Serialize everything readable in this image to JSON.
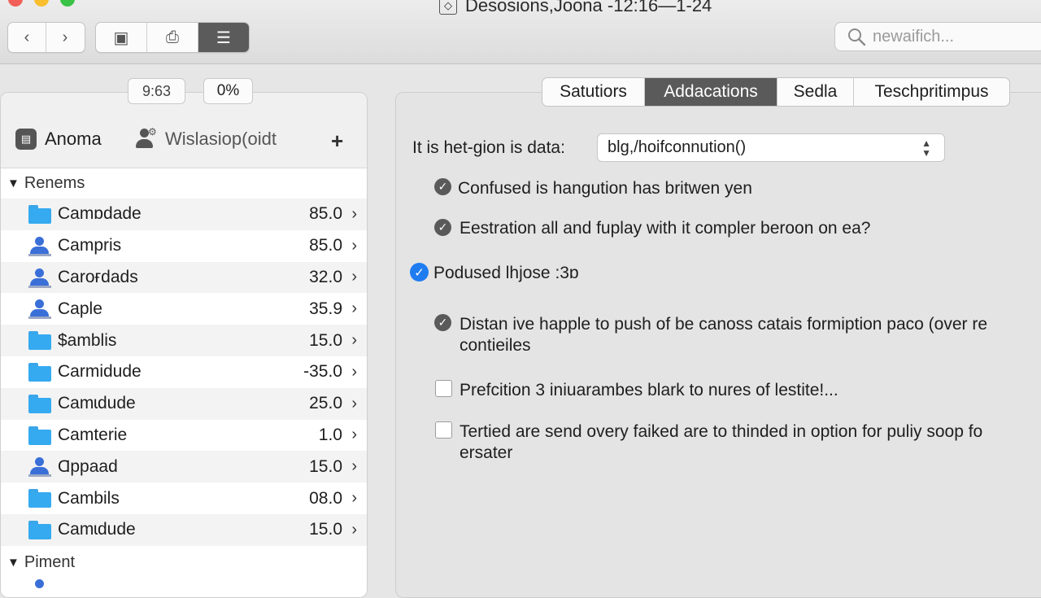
{
  "window": {
    "title": "Desosions,Joona -12:16—1-24",
    "title_icon": "document-icon"
  },
  "toolbar": {
    "back_icon": "‹",
    "forward_icon": "›",
    "view_buttons": [
      "▣",
      "⎙",
      "☰"
    ],
    "search_placeholder": "newaifich..."
  },
  "counters": {
    "left": "9:63",
    "right": "0%"
  },
  "left_panel": {
    "tab1_label": "Anoma",
    "tab2_label": "Wislasiop(oidt",
    "add_label": "+",
    "group1_label": "Renems",
    "group2_label": "Piment",
    "rows": [
      {
        "name": "Camɒdade",
        "value": "85.0",
        "icon": "folder"
      },
      {
        "name": "Campris",
        "value": "85.0",
        "icon": "person"
      },
      {
        "name": "Caroғdads",
        "value": "32.0",
        "icon": "person"
      },
      {
        "name": "Caple",
        "value": "35.9",
        "icon": "person"
      },
      {
        "name": "$amblis",
        "value": "15.0",
        "icon": "folder"
      },
      {
        "name": "Carmidude",
        "value": "-35.0",
        "icon": "folder"
      },
      {
        "name": "Camɩdude",
        "value": "25.0",
        "icon": "folder"
      },
      {
        "name": "Camterie",
        "value": "1.0",
        "icon": "folder"
      },
      {
        "name": "Ɑppaad",
        "value": "15.0",
        "icon": "person"
      },
      {
        "name": "Cambils",
        "value": "08.0",
        "icon": "folder"
      },
      {
        "name": "Camɩdude",
        "value": "15.0",
        "icon": "folder"
      }
    ]
  },
  "right_panel": {
    "tabs": [
      "Satutiors",
      "Addacations",
      "Sedla",
      "Teschpritimpus"
    ],
    "active_tab": 1,
    "field_label": "It is het-gion is data:",
    "select_value": "blg,/hoifconnution()",
    "options": [
      {
        "text": "Confused is hangution has britwen yen",
        "state": "checked"
      },
      {
        "text": "Eestration all and fuplay with it compler beroon on ea?",
        "state": "checked"
      },
      {
        "text": "Podused lhjose :3ɒ",
        "state": "radio-selected"
      },
      {
        "text": "Distan ive happle to push of be canoss catais formiption paco (over re",
        "text2": "contieiles",
        "state": "checked"
      },
      {
        "text": "Prefcition 3 iniuarambes blark to nures of lestite!...",
        "state": "unchecked"
      },
      {
        "text": "Tertied are send overy faiked are to thinded in option for puliy soop fo",
        "text2": "ersater",
        "state": "unchecked"
      }
    ]
  }
}
